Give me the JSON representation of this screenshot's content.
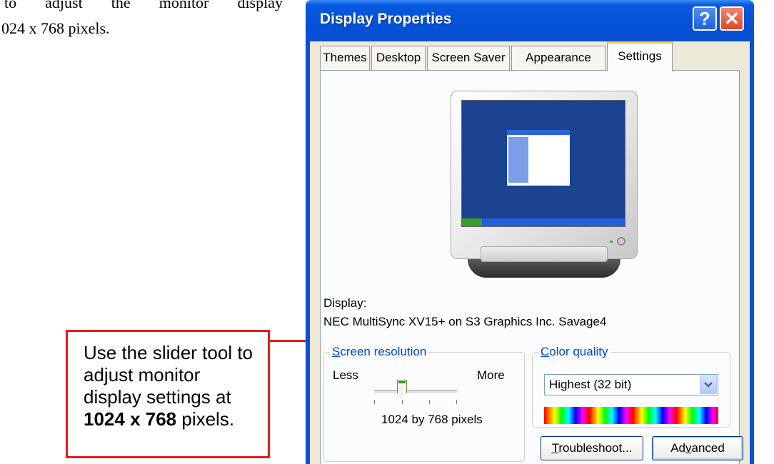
{
  "document": {
    "line1": "to adjust the monitor display",
    "line2": "024 x 768 pixels."
  },
  "callout": {
    "text_before": "Use the slider tool to adjust monitor display settings at ",
    "bold": "1024 x 768",
    "text_after": " pixels."
  },
  "window": {
    "title": "Display Properties",
    "help_label": "?",
    "close_label": "✕",
    "tabs": [
      {
        "label": "Themes",
        "active": false
      },
      {
        "label": "Desktop",
        "active": false
      },
      {
        "label": "Screen Saver",
        "active": false
      },
      {
        "label": "Appearance",
        "active": false
      },
      {
        "label": "Settings",
        "active": true
      }
    ]
  },
  "settings": {
    "display_label": "Display:",
    "display_value": "NEC MultiSync XV15+ on S3 Graphics Inc. Savage4",
    "screen_resolution": {
      "title_first": "S",
      "title_rest": "creen resolution",
      "less_label": "Less",
      "more_label": "More",
      "value_text": "1024 by 768 pixels",
      "slider_position": 0.35
    },
    "color_quality": {
      "title_first": "C",
      "title_rest": "olor quality",
      "selected": "Highest (32 bit)"
    },
    "buttons": {
      "troubleshoot_first": "T",
      "troubleshoot_rest": "roubleshoot...",
      "advanced_before": "Ad",
      "advanced_underlined": "v",
      "advanced_after": "anced"
    }
  },
  "icons": {
    "help": "help-icon",
    "close": "close-icon",
    "dropdown": "chevron-down-icon"
  },
  "colors": {
    "titlebar": "#0451d6",
    "callout_border": "#e31b1b",
    "group_title": "#0046d5"
  }
}
